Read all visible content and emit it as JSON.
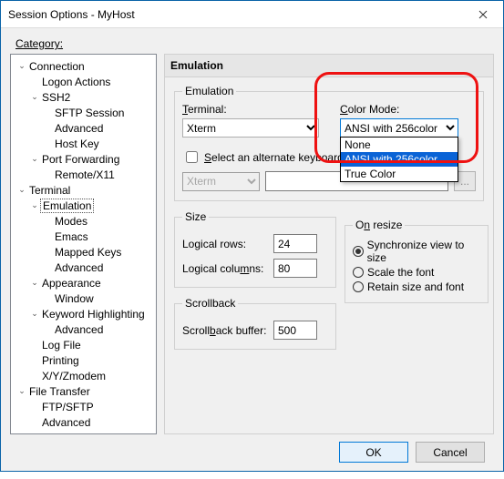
{
  "title": "Session Options - MyHost",
  "categoryLabel": "Category:",
  "sectionTitle": "Emulation",
  "tree": {
    "connection": "Connection",
    "logonActions": "Logon Actions",
    "ssh2": "SSH2",
    "sftpSession": "SFTP Session",
    "advanced": "Advanced",
    "hostKey": "Host Key",
    "portForwarding": "Port Forwarding",
    "remoteX11": "Remote/X11",
    "terminal": "Terminal",
    "emulation": "Emulation",
    "modes": "Modes",
    "emacs": "Emacs",
    "mappedKeys": "Mapped Keys",
    "appearance": "Appearance",
    "window": "Window",
    "keywordHighlighting": "Keyword Highlighting",
    "logFile": "Log File",
    "printing": "Printing",
    "xyzmodem": "X/Y/Zmodem",
    "fileTransfer": "File Transfer",
    "ftpsftp": "FTP/SFTP"
  },
  "emulation": {
    "group": "Emulation",
    "terminalLabelPre": "T",
    "terminalLabelPost": "erminal:",
    "terminalValue": "Xterm",
    "colorModeLabelPre": "C",
    "colorModeLabelPost": "olor Mode:",
    "colorModeValue": "ANSI with 256color",
    "colorModeOptions": {
      "none": "None",
      "ansi256": "ANSI with 256color",
      "true": "True Color"
    },
    "altCheckboxPre": "S",
    "altCheckboxPost": "elect an alternate keyboard emulation",
    "altSelect": "Xterm",
    "dots": "..."
  },
  "size": {
    "group": "Size",
    "rowsLabelPre": "Lo",
    "rowsLabelU": "g",
    "rowsLabelPost": "ical rows:",
    "rowsValue": "24",
    "colsLabelPre": "Logical colu",
    "colsLabelU": "m",
    "colsLabelPost": "ns:",
    "colsValue": "80"
  },
  "resize": {
    "groupPre": "O",
    "groupU": "n",
    "groupPost": " resize",
    "sync": "Synchronize view to size",
    "scale": "Scale the font",
    "retain": "Retain size and font"
  },
  "scrollback": {
    "group": "Scrollback",
    "labelPre": "Scroll",
    "labelU": "b",
    "labelPost": "ack buffer:",
    "value": "500"
  },
  "buttons": {
    "ok": "OK",
    "cancel": "Cancel"
  }
}
